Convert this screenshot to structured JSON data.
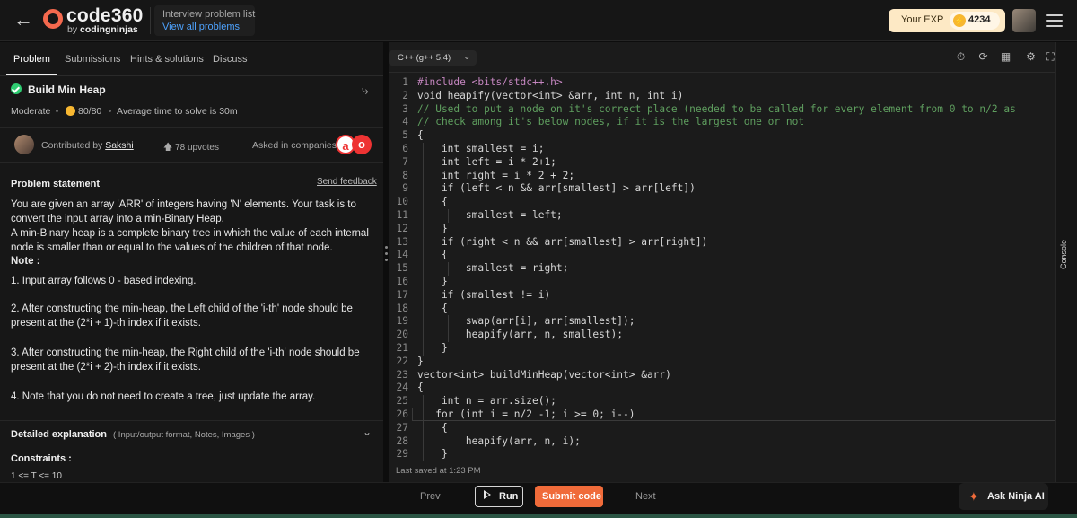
{
  "header": {
    "back_icon": "arrow-left-icon",
    "logo_text": "code360",
    "logo_by": "by",
    "logo_brand": "codingninjas",
    "crumb_title": "Interview problem list",
    "crumb_link": "View all problems",
    "exp_label": "Your EXP",
    "exp_value": "4234"
  },
  "tabs": [
    {
      "label": "Problem"
    },
    {
      "label": "Submissions"
    },
    {
      "label": "Hints & solutions"
    },
    {
      "label": "Discuss"
    }
  ],
  "problem": {
    "title": "Build Min Heap",
    "difficulty": "Moderate",
    "score": "80/80",
    "avg_time": "Average time to solve is 30m",
    "contributed_by": "Contributed by",
    "contributor": "Sakshi",
    "upvotes": "78 upvotes",
    "asked_in": "Asked in companies",
    "statement_title": "Problem statement",
    "send_feedback": "Send feedback",
    "p1": "You are given an array 'ARR' of integers having 'N' elements. Your task is to convert the input array into a min-Binary Heap.",
    "p2": "A min-Binary heap is a complete binary tree in which the value of each internal node is smaller than or equal to the values of the children of that node.",
    "note": "Note :",
    "n1": "1. Input array follows 0 - based indexing.",
    "n2": "2. After constructing the min-heap, the Left child of the 'i-th' node should be present at the (2*i + 1)-th index if it exists.",
    "n3": "3. After constructing the min-heap, the Right child of the 'i-th' node should be present at the (2*i + 2)-th index if it exists.",
    "n4": "4. Note that you do not need to create a tree, just update the array.",
    "detailed": "Detailed explanation",
    "detailed_sub": "( Input/output format, Notes, Images )",
    "constraints": "Constraints :",
    "constraints_line": "1 <= T <= 10"
  },
  "editor": {
    "language": "C++ (g++ 5.4)",
    "last_saved": "Last saved at 1:23 PM",
    "lines": [
      "#include <bits/stdc++.h>",
      "void heapify(vector<int> &arr, int n, int i)",
      "// Used to put a node on it's correct place (needed to be called for every element from 0 to n/2 as",
      "// check among it's below nodes, if it is the largest one or not",
      "{",
      "    int smallest = i;",
      "    int left = i * 2+1;",
      "    int right = i * 2 + 2;",
      "    if (left < n && arr[smallest] > arr[left])",
      "    {",
      "        smallest = left;",
      "    }",
      "    if (right < n && arr[smallest] > arr[right])",
      "    {",
      "        smallest = right;",
      "    }",
      "    if (smallest != i)",
      "    {",
      "        swap(arr[i], arr[smallest]);",
      "        heapify(arr, n, smallest);",
      "    }",
      "}",
      "vector<int> buildMinHeap(vector<int> &arr)",
      "{",
      "    int n = arr.size();",
      "   for (int i = n/2 -1; i >= 0; i--)",
      "    {",
      "        heapify(arr, n, i);",
      "    }"
    ]
  },
  "console_label": "Console",
  "footer": {
    "prev": "Prev",
    "run": "Run",
    "submit": "Submit code",
    "next": "Next",
    "ask_ninja": "Ask Ninja AI"
  },
  "colors": {
    "accent": "#f06b3a",
    "brand": "#f4694e",
    "success": "#2ecc71",
    "link": "#4ea3ff"
  }
}
